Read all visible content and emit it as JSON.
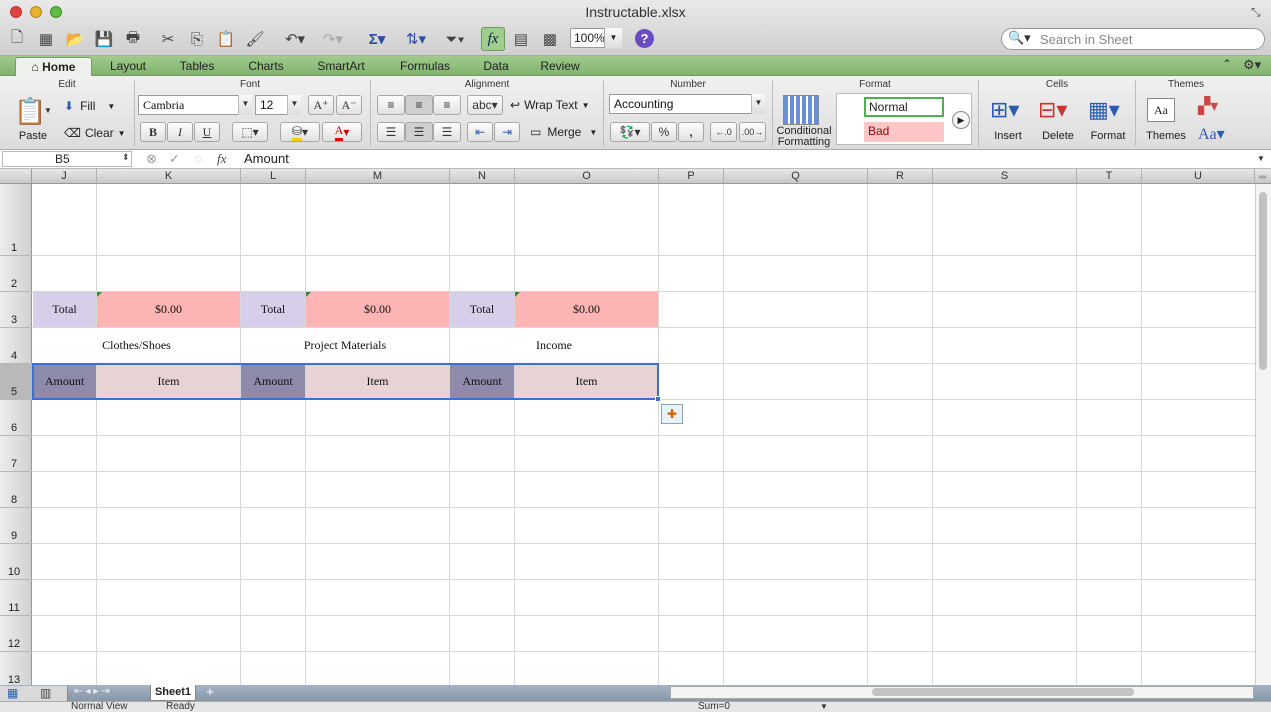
{
  "window": {
    "title": "Instructable.xlsx"
  },
  "toolbar": {
    "zoom": "100%",
    "search_placeholder": "Search in Sheet"
  },
  "ribbon_tabs": [
    "Home",
    "Layout",
    "Tables",
    "Charts",
    "SmartArt",
    "Formulas",
    "Data",
    "Review"
  ],
  "ribbon": {
    "groups": {
      "edit": "Edit",
      "font": "Font",
      "alignment": "Alignment",
      "number": "Number",
      "format": "Format",
      "cells": "Cells",
      "themes": "Themes"
    },
    "paste": "Paste",
    "fill": "Fill",
    "clear": "Clear",
    "font_name": "Cambria",
    "font_size": "12",
    "bold": "B",
    "italic": "I",
    "underline": "U",
    "wrap_text": "Wrap Text",
    "merge": "Merge",
    "abc": "abc",
    "number_format": "Accounting",
    "percent": "%",
    "comma": ",",
    "conditional_formatting": "Conditional\nFormatting",
    "style_normal": "Normal",
    "style_bad": "Bad",
    "insert": "Insert",
    "delete": "Delete",
    "format": "Format",
    "themes": "Themes",
    "theme_fonts": "Aa"
  },
  "formula_bar": {
    "cell_ref": "B5",
    "fx": "fx",
    "content": "Amount"
  },
  "columns": [
    "J",
    "K",
    "L",
    "M",
    "N",
    "O",
    "P",
    "Q",
    "R",
    "S",
    "T",
    "U"
  ],
  "rows": [
    "1",
    "2",
    "3",
    "4",
    "5",
    "6",
    "7",
    "8",
    "9",
    "10",
    "11",
    "12",
    "13"
  ],
  "cells": {
    "r3": [
      "Total",
      "$0.00",
      "Total",
      "$0.00",
      "Total",
      "$0.00"
    ],
    "r4": [
      "Clothes/Shoes",
      "Project Materials",
      "Income"
    ],
    "r5": [
      "Amount",
      "Item",
      "Amount",
      "Item",
      "Amount",
      "Item"
    ]
  },
  "colors": {
    "total_bg": "#d7cfe9",
    "value_bg": "#fcb5b4",
    "amount_bg": "#8e8aa9",
    "item_bg": "#e7d3d3",
    "selection": "#3b6fd1",
    "ribbon_tabs": "#8fbf7c"
  },
  "sheet": {
    "tab": "Sheet1",
    "add": "+"
  },
  "status": {
    "view": "Normal View",
    "state": "Ready",
    "sum": "Sum=0"
  }
}
